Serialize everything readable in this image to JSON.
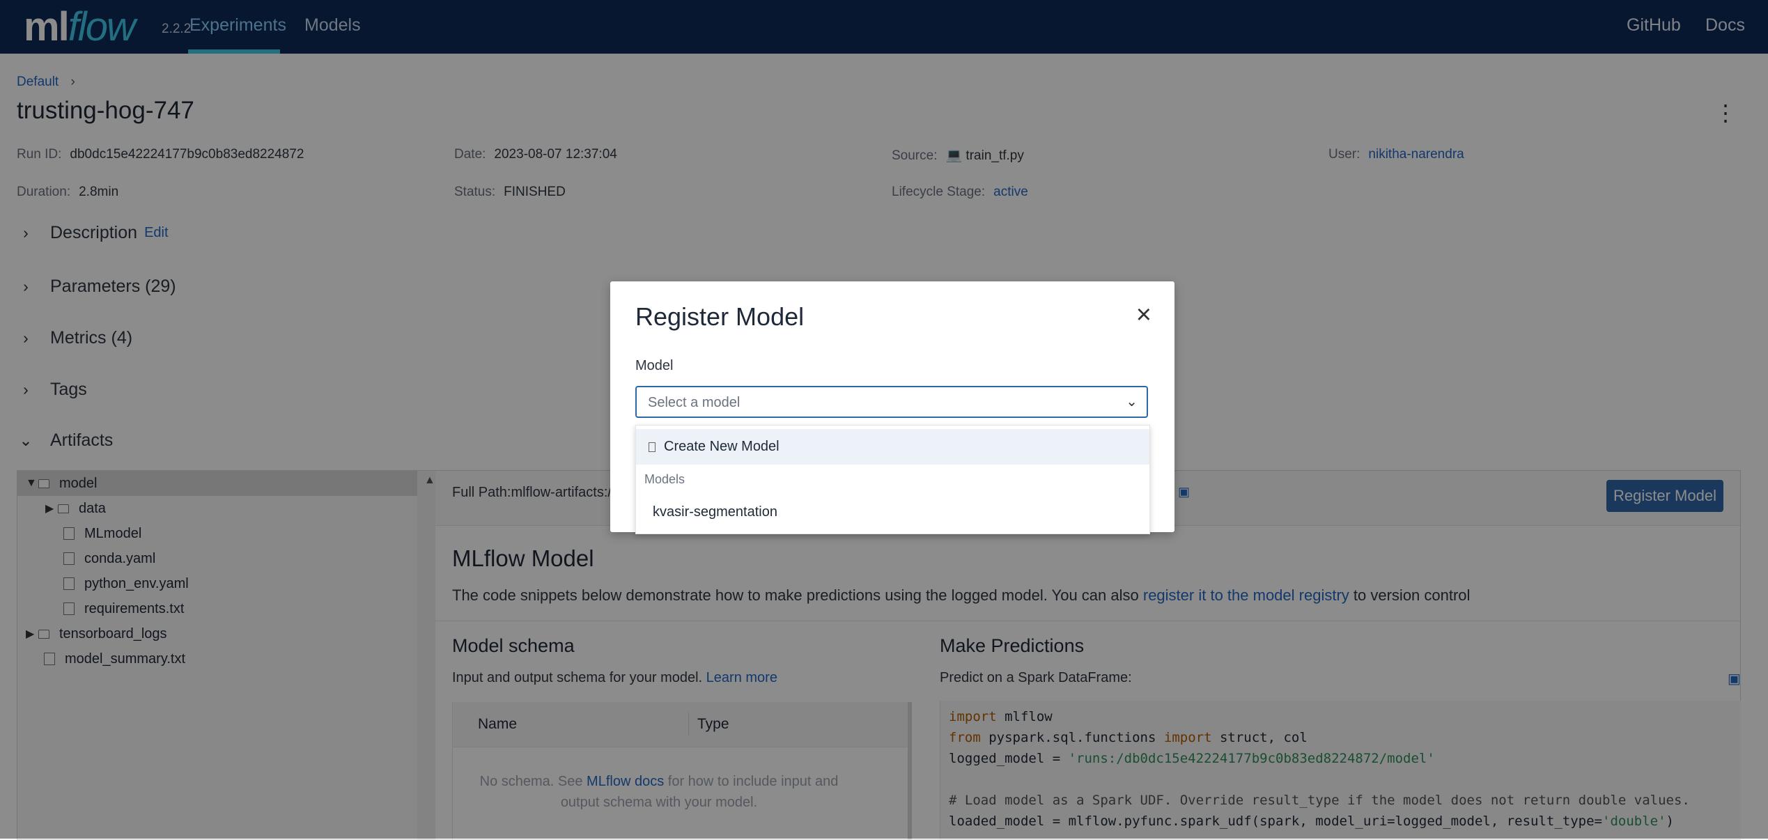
{
  "top_nav": {
    "logo_ml": "ml",
    "logo_flow": "flow",
    "version": "2.2.2",
    "experiments": "Experiments",
    "models": "Models",
    "github": "GitHub",
    "docs": "Docs"
  },
  "run": {
    "breadcrumb": "Default",
    "breadcrumb_sep": "›",
    "title": "trusting-hog-747",
    "metadata": {
      "run_id_label": "Run ID:",
      "run_id_value": "db0dc15e42224177b9c0b83ed8224872",
      "date_label": "Date:",
      "date_value": "2023-08-07 12:37:04",
      "source_label": "Source:",
      "source_value": "train_tf.py",
      "user_label": "User:",
      "user_value": "nikitha-narendra",
      "duration_label": "Duration:",
      "duration_value": "2.8min",
      "status_label": "Status:",
      "status_value": "FINISHED",
      "lifecycle_label": "Lifecycle Stage:",
      "lifecycle_value": "active"
    }
  },
  "sections": {
    "description": "Description",
    "description_edit": "Edit",
    "parameters": "Parameters (29)",
    "metrics": "Metrics (4)",
    "tags": "Tags",
    "artifacts": "Artifacts"
  },
  "artifacts": {
    "tree": [
      {
        "name": "model",
        "icon": "folder-icon",
        "expanded": true
      },
      {
        "name": "data",
        "icon": "folder-icon"
      },
      {
        "name": "MLmodel",
        "icon": "file-icon"
      },
      {
        "name": "conda.yaml",
        "icon": "file-icon"
      },
      {
        "name": "python_env.yaml",
        "icon": "file-icon"
      },
      {
        "name": "requirements.txt",
        "icon": "file-icon"
      },
      {
        "name": "tensorboard_logs",
        "icon": "folder-icon"
      },
      {
        "name": "model_summary.txt",
        "icon": "file-icon"
      }
    ],
    "full_path": "Full Path:mlflow-artifacts:/",
    "register_button": "Register Model",
    "model_heading": "MLflow Model",
    "model_description_prefix": "The code snippets below demonstrate how to make predictions using the logged model. You can also",
    "model_description_link": "register it to the model registry",
    "model_description_suffix": "to version control",
    "schema_title": "Model schema",
    "schema_description": "Input and output schema for your model.",
    "schema_learn_more": "Learn more",
    "schema_columns": {
      "name": "Name",
      "type": "Type"
    },
    "schema_empty_prefix": "No schema. See",
    "schema_empty_link": "MLflow docs",
    "schema_empty_suffix": "for how to include input and output schema with your model.",
    "predictions_title": "Make Predictions",
    "predictions_description": "Predict on a Spark DataFrame:",
    "code_lines": [
      "import mlflow",
      "from pyspark.sql.functions import struct, col",
      "logged_model = 'runs:/db0dc15e42224177b9c0b83ed8224872/model'",
      "",
      "# Load model as a Spark UDF. Override result_type if the model does not return double values.",
      "loaded_model = mlflow.pyfunc.spark_udf(spark, model_uri=logged_model, result_type='double')"
    ]
  },
  "modal": {
    "title": "Register Model",
    "field_label": "Model",
    "select_placeholder": "Select a model",
    "dropdown": {
      "create_new": "Create New Model",
      "group_label": "Models",
      "items": [
        "kvasir-segmentation"
      ]
    }
  },
  "colors": {
    "nav_bg": "#0b2a57",
    "accent": "#43c9ed",
    "link": "#2468c5",
    "primary_button": "#2e67a8"
  }
}
